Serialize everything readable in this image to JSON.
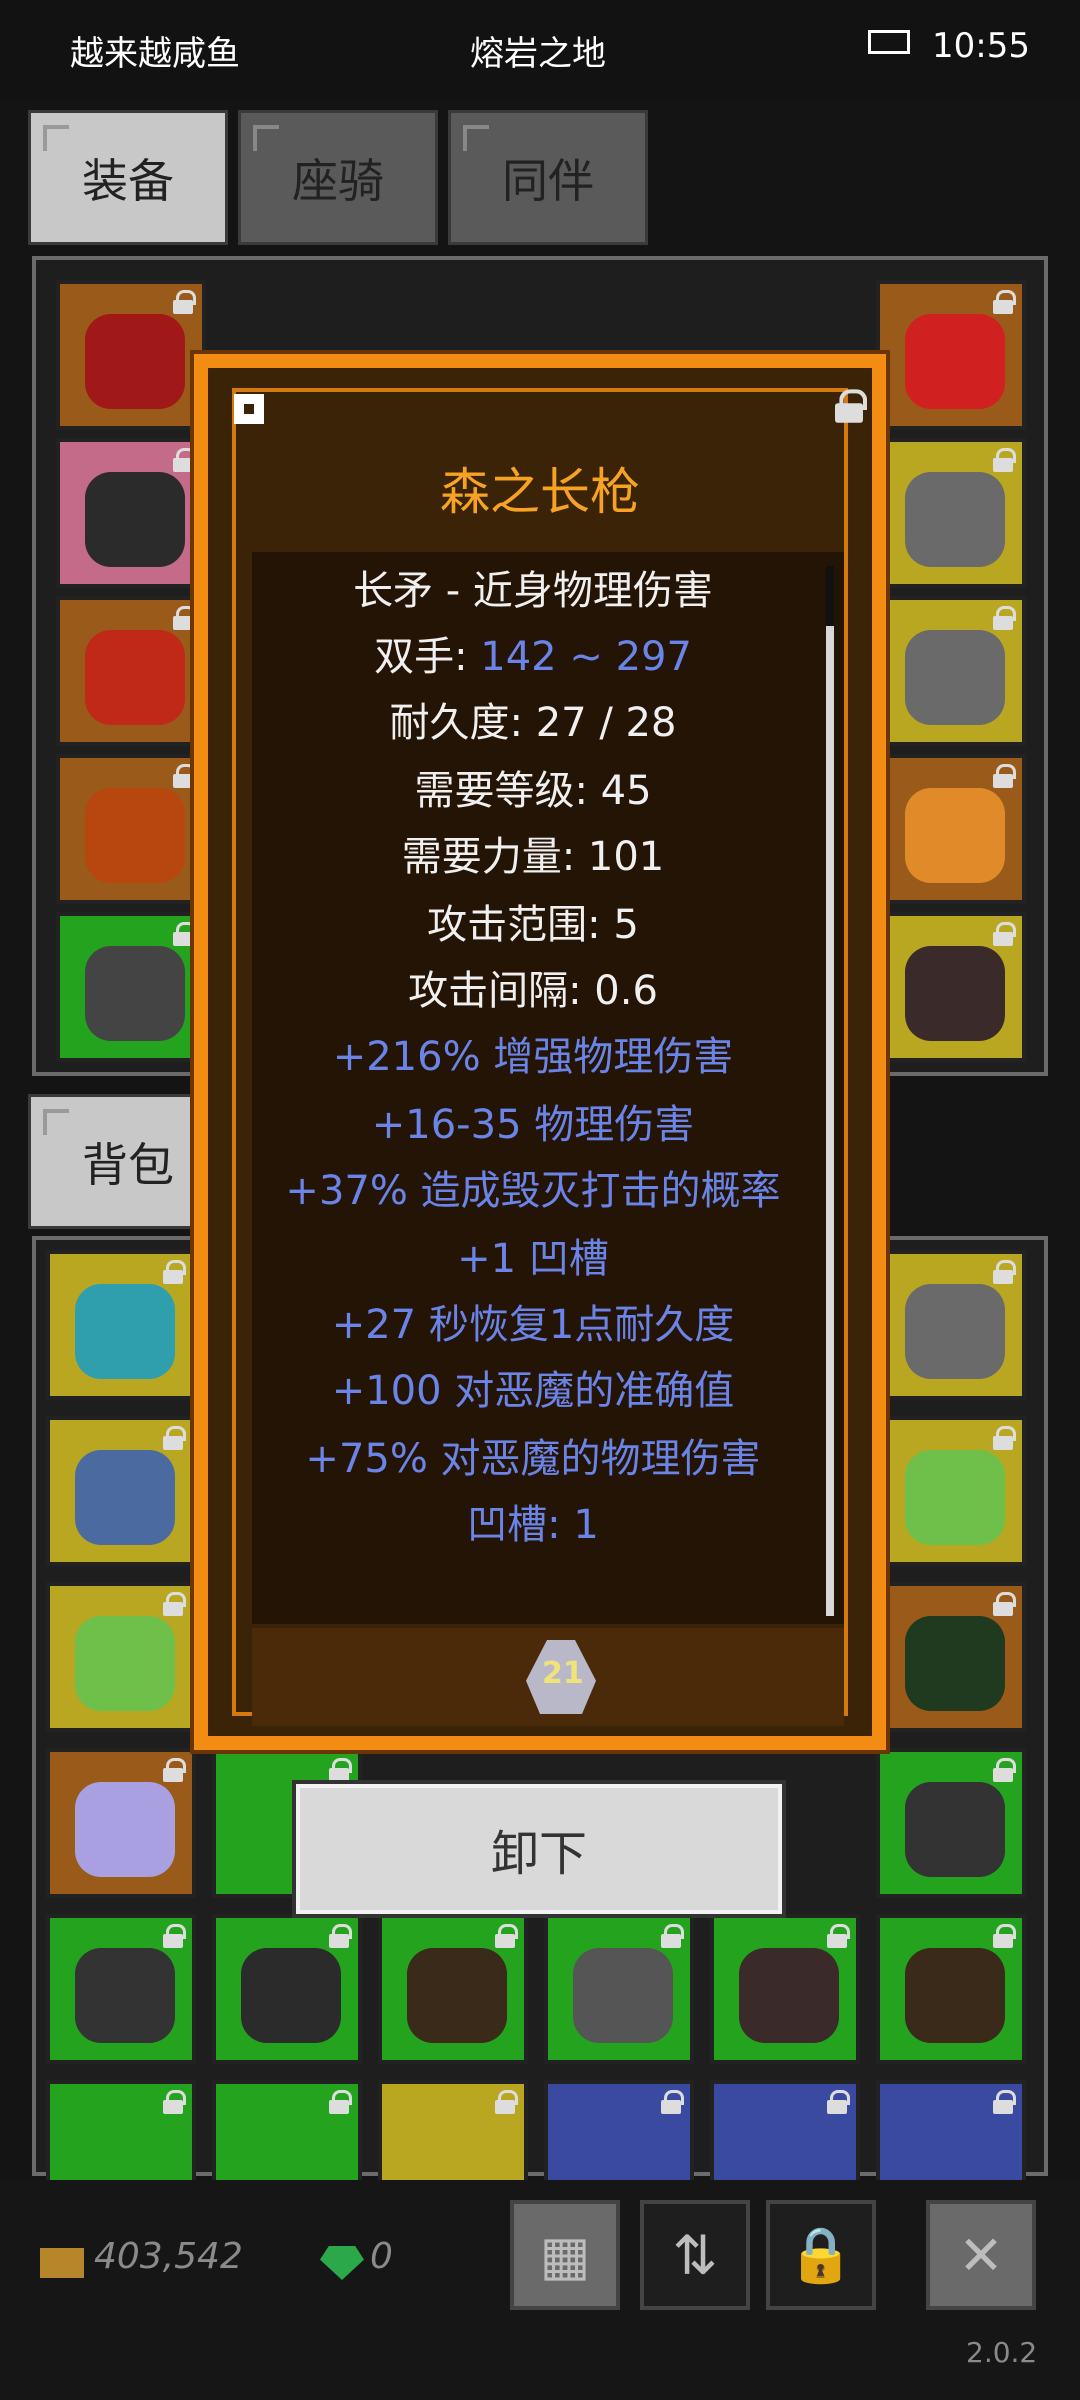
{
  "status_bar": {
    "left_text": "越来越咸鱼",
    "title": "熔岩之地",
    "time": "10:55",
    "battery_icon": "battery-icon"
  },
  "tabs": [
    {
      "label": "装备",
      "active": true
    },
    {
      "label": "座骑",
      "active": false
    },
    {
      "label": "同伴",
      "active": false
    }
  ],
  "inventory_tab": {
    "label": "背包"
  },
  "modal": {
    "title": "森之长枪",
    "lines": [
      {
        "text": "长矛 - 近身物理伤害",
        "color": "white"
      },
      {
        "prefix": "双手: ",
        "value": "142 ~ 297",
        "color": "white"
      },
      {
        "text": "耐久度: 27 / 28",
        "color": "white"
      },
      {
        "text": "需要等级: 45",
        "color": "white"
      },
      {
        "text": "需要力量: 101",
        "color": "white"
      },
      {
        "text": "攻击范围: 5",
        "color": "white"
      },
      {
        "text": "攻击间隔: 0.6",
        "color": "white"
      },
      {
        "text": "+216% 增强物理伤害",
        "color": "blue"
      },
      {
        "text": "+16-35 物理伤害",
        "color": "blue"
      },
      {
        "text": "+37% 造成毁灭打击的概率",
        "color": "blue"
      },
      {
        "text": "+1 凹槽",
        "color": "blue"
      },
      {
        "text": "+27 秒恢复1点耐久度",
        "color": "blue"
      },
      {
        "text": "+100 对恶魔的准确值",
        "color": "blue"
      },
      {
        "text": "+75% 对恶魔的物理伤害",
        "color": "blue"
      },
      {
        "text": "凹槽: 1",
        "color": "blue"
      }
    ],
    "gem_label": "21"
  },
  "actions": {
    "unequip_label": "卸下"
  },
  "currency": {
    "gold": "403,542",
    "gems": "0"
  },
  "footer": {
    "version": "2.0.2"
  },
  "colors": {
    "accent_orange": "#f28c12",
    "title_orange": "#f7a223",
    "blue_text": "#6a84e8"
  }
}
